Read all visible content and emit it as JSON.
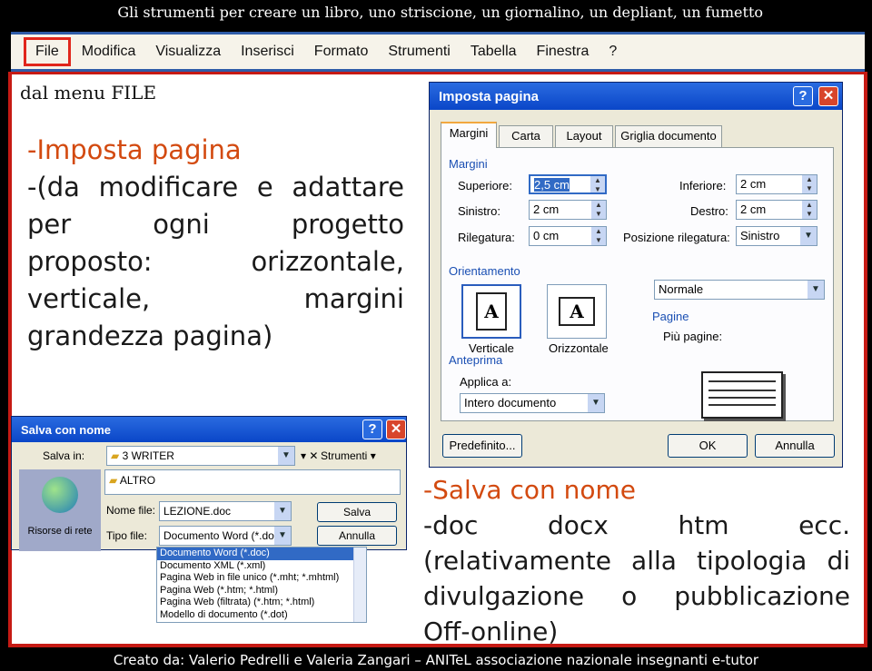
{
  "slide": {
    "title": "Gli strumenti per creare un libro, uno striscione, un giornalino, un depliant, un fumetto",
    "footer": "Creato da: Valerio Pedrelli e Valeria Zangari – ANITeL associazione nazionale insegnanti e-tutor"
  },
  "menubar": {
    "items": [
      "File",
      "Modifica",
      "Visualizza",
      "Inserisci",
      "Formato",
      "Strumenti",
      "Tabella",
      "Finestra",
      "?"
    ]
  },
  "left_text": {
    "from_menu": "dal menu FILE",
    "heading": "-Imposta pagina",
    "lines": [
      "-(da modificare e adattare",
      "per ogni progetto",
      "proposto: orizzontale,",
      "verticale, margini",
      "grandezza pagina)"
    ]
  },
  "right_text": {
    "heading": "-Salva con nome",
    "lines": [
      "-doc docx htm ecc.",
      "(relativamente alla tipologia di",
      "divulgazione o pubblicazione",
      "Off-online)"
    ]
  },
  "page_setup": {
    "title": "Imposta pagina",
    "help": "?",
    "close": "✕",
    "tabs": [
      "Margini",
      "Carta",
      "Layout",
      "Griglia documento"
    ],
    "margins_group": "Margini",
    "superiore_label": "Superiore:",
    "superiore_value": "2,5 cm",
    "inferiore_label": "Inferiore:",
    "inferiore_value": "2 cm",
    "sinistro_label": "Sinistro:",
    "sinistro_value": "2 cm",
    "destro_label": "Destro:",
    "destro_value": "2 cm",
    "rilegatura_label": "Rilegatura:",
    "rilegatura_value": "0 cm",
    "posizione_label": "Posizione rilegatura:",
    "posizione_value": "Sinistro",
    "orientamento_group": "Orientamento",
    "verticale": "Verticale",
    "orizzontale": "Orizzontale",
    "icon_letter": "A",
    "pagine_group": "Pagine",
    "piu_pagine_label": "Più pagine:",
    "piu_pagine_value": "Normale",
    "anteprima_group": "Anteprima",
    "applica_label": "Applica a:",
    "applica_value": "Intero documento",
    "predefinito": "Predefinito...",
    "ok": "OK",
    "annulla": "Annulla"
  },
  "save_dialog": {
    "title": "Salva con nome",
    "help": "?",
    "close": "✕",
    "salva_in_label": "Salva in:",
    "salva_in_value": "3 WRITER",
    "strumenti": "Strumenti",
    "folder_item": "ALTRO",
    "sidebar_label": "Risorse di rete",
    "nome_file_label": "Nome file:",
    "nome_file_value": "LEZIONE.doc",
    "tipo_file_label": "Tipo file:",
    "tipo_file_value": "Documento Word (*.doc)",
    "salva": "Salva",
    "annulla": "Annulla",
    "file_types": [
      "Documento Word (*.doc)",
      "Documento XML (*.xml)",
      "Pagina Web in file unico (*.mht; *.mhtml)",
      "Pagina Web (*.htm; *.html)",
      "Pagina Web (filtrata) (*.htm; *.html)",
      "Modello di documento (*.dot)"
    ]
  },
  "colors": {
    "accent_red": "#c61a14",
    "heading_orange": "#d34a10",
    "titlebar_blue": "#2a6be0"
  }
}
